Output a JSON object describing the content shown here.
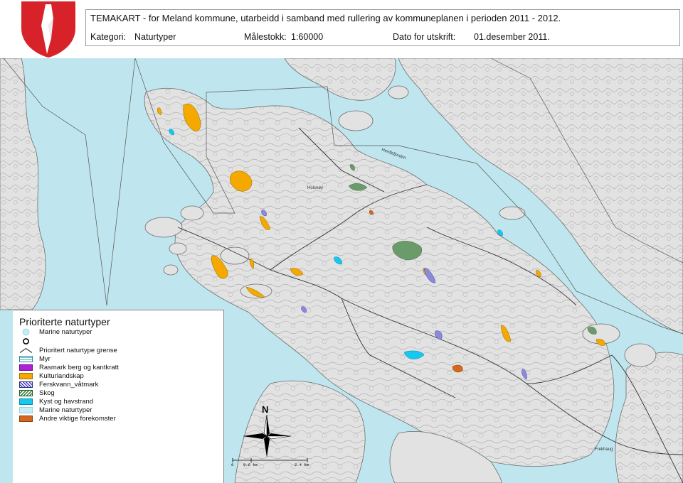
{
  "header": {
    "title": "TEMAKART - for Meland kommune, utarbeidd i samband med rullering av kommuneplanen i perioden 2011 - 2012.",
    "category_label": "Kategori:",
    "category_value": "Naturtyper",
    "scale_label": "Målestokk:",
    "scale_value": "1:60000",
    "date_label": "Dato for utskrift:",
    "date_value": "01.desember 2011."
  },
  "legend": {
    "title": "Prioriterte naturtyper",
    "items": [
      {
        "label": "Marine naturtyper",
        "swatch": "circle-light",
        "color": "#c3ecf3"
      },
      {
        "label": "",
        "swatch": "ring-black",
        "color": "#000000"
      },
      {
        "label": "Prioritert naturtype grense",
        "swatch": "boundary-line",
        "color": "#000000"
      },
      {
        "label": "Myr",
        "swatch": "hatch-teal",
        "color": "#5bb8c8"
      },
      {
        "label": "Rasmark berg og kantkratt",
        "swatch": "fill",
        "color": "#b21fd8"
      },
      {
        "label": "Kulturlandskap",
        "swatch": "fill",
        "color": "#f5a800"
      },
      {
        "label": "Ferskvann_våtmark",
        "swatch": "hatch-blue",
        "color": "#3c3cb4"
      },
      {
        "label": "Skog",
        "swatch": "hatch-green",
        "color": "#2e7d32"
      },
      {
        "label": "Kyst og havstrand",
        "swatch": "fill",
        "color": "#16c7f0"
      },
      {
        "label": "Marine naturtyper",
        "swatch": "fill",
        "color": "#c7eef7"
      },
      {
        "label": "Andre viktige forekomster",
        "swatch": "fill",
        "color": "#d2691e"
      }
    ]
  },
  "map": {
    "north_label": "N",
    "scale_ticks": [
      "0",
      "0.6 km",
      "2.4 km"
    ],
    "place_names": [
      "Frekhaug",
      "Holsnøy",
      "Herdlefjorden"
    ],
    "colors": {
      "sea": "#bfe6ee",
      "land": "#e4e4e4",
      "contour": "#7a7a7a",
      "road": "#3a3a3a"
    }
  }
}
